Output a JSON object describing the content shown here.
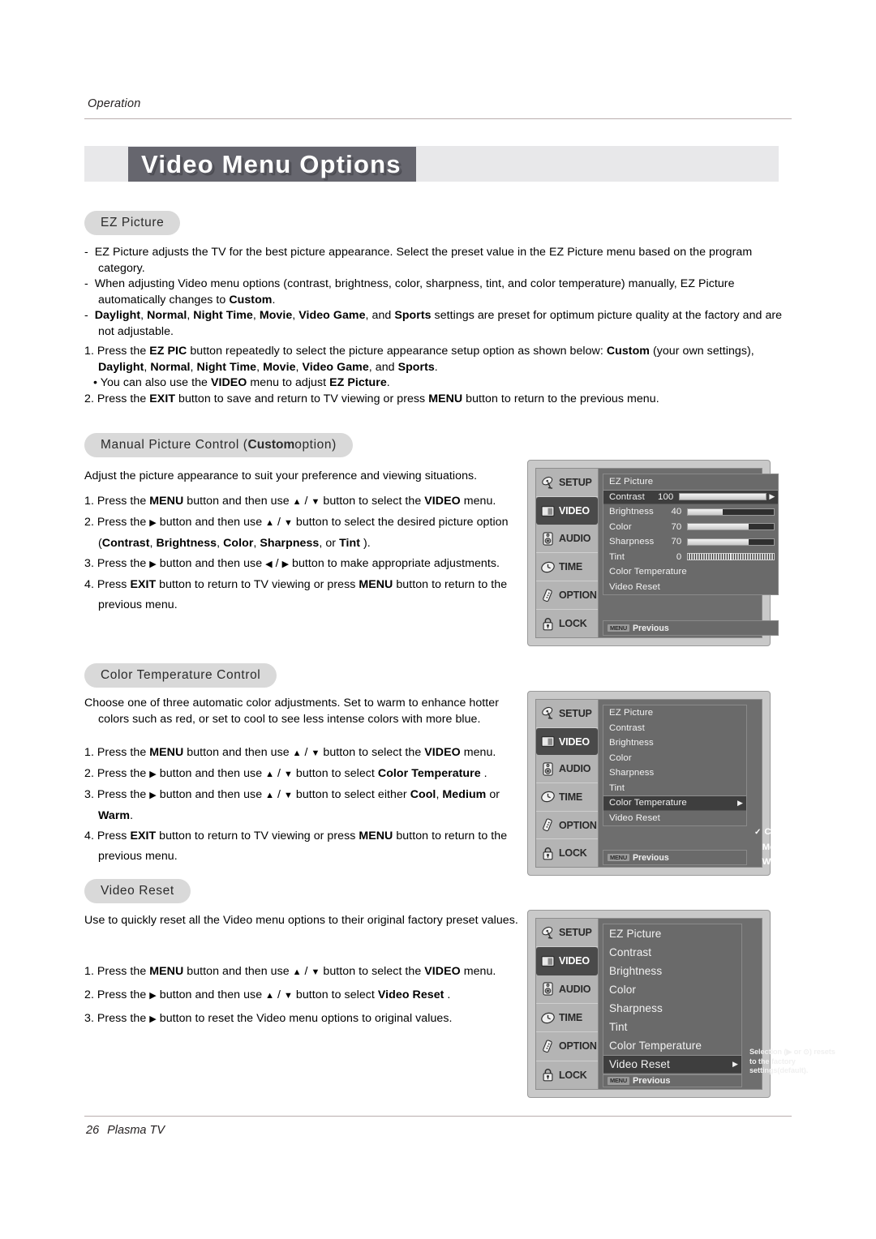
{
  "header": {
    "section_label": "Operation"
  },
  "title": {
    "text": "Video Menu Options"
  },
  "footer": {
    "page_number": "26",
    "product": "Plasma TV"
  },
  "sections": {
    "ez_picture": {
      "pill": "EZ Picture",
      "bullets": [
        "EZ Picture adjusts the TV for the best picture appearance. Select the preset value in the EZ Picture menu based on the program category.",
        "When adjusting Video menu options (contrast, brightness, color, sharpness, tint, and color temperature) manually, EZ Picture automatically changes to Custom.",
        "Daylight, Normal, Night Time, Movie, Video Game, and Sports settings are preset for optimum picture quality at the factory and are not adjustable."
      ],
      "steps": [
        "1. Press the EZ PIC button repeatedly to select the picture appearance setup option as shown below: Custom (your own settings), Daylight, Normal, Night Time, Movie, Video Game, and Sports.",
        "• You can also use the VIDEO menu to adjust EZ Picture.",
        "2. Press the EXIT button to save and return to TV viewing or press MENU button to return to the previous menu."
      ]
    },
    "manual_picture": {
      "pill_prefix": "Manual Picture Control (",
      "pill_bold": "Custom",
      "pill_suffix": " option)",
      "bullet": "Adjust the picture appearance to suit your preference and viewing situations.",
      "steps": [
        "1. Press the MENU button and then use ▲ / ▼ button to select the VIDEO menu.",
        "2. Press the ▶ button and then use ▲ / ▼ button to select the desired picture option (Contrast, Brightness, Color, Sharpness, or Tint ).",
        "3. Press the ▶ button and then use ◀ / ▶ button to make appropriate adjustments.",
        "4. Press EXIT button to return to TV viewing or press MENU button to return to the previous menu."
      ]
    },
    "color_temperature": {
      "pill": "Color Temperature Control",
      "bullet": "Choose one of three automatic color adjustments. Set to warm to enhance hotter colors such as red, or set to cool to see less intense colors with more blue.",
      "steps": [
        "1. Press the MENU button and then use ▲ / ▼ button to select the VIDEO menu.",
        "2. Press the ▶ button and then use ▲ / ▼ button to select Color Temperature .",
        "3. Press the ▶ button and then use ▲ / ▼ button to select either Cool, Medium or Warm.",
        "4. Press EXIT button to return to TV viewing or press MENU button to return to the previous menu."
      ]
    },
    "video_reset": {
      "pill": "Video Reset",
      "bullet": "Use to quickly reset all the Video menu options to their original factory preset values.",
      "steps": [
        "1. Press the MENU button and then use ▲ / ▼ button to select the VIDEO menu.",
        "2. Press the ▶ button and then use ▲ / ▼ button to select Video Reset .",
        "3. Press the ▶ button to reset the Video menu options to original values."
      ]
    }
  },
  "osd": {
    "sidebar": [
      {
        "label": "SETUP",
        "icon": "satellite-dish-icon"
      },
      {
        "label": "VIDEO",
        "icon": "tv-screen-icon"
      },
      {
        "label": "AUDIO",
        "icon": "speaker-icon"
      },
      {
        "label": "TIME",
        "icon": "clock-icon"
      },
      {
        "label": "OPTION",
        "icon": "remote-control-icon"
      },
      {
        "label": "LOCK",
        "icon": "padlock-icon"
      }
    ],
    "previous_key": "MENU",
    "previous_label": "Previous",
    "menu1": {
      "rows": [
        {
          "label": "EZ Picture",
          "value": "",
          "bar": null,
          "selected": false
        },
        {
          "label": "Contrast",
          "value": "100",
          "bar": 100,
          "selected": true
        },
        {
          "label": "Brightness",
          "value": "40",
          "bar": 40,
          "selected": false
        },
        {
          "label": "Color",
          "value": "70",
          "bar": 70,
          "selected": false
        },
        {
          "label": "Sharpness",
          "value": "70",
          "bar": 70,
          "selected": false
        },
        {
          "label": "Tint",
          "value": "0",
          "bar": "tint",
          "selected": false
        },
        {
          "label": "Color Temperature",
          "value": "",
          "bar": null,
          "selected": false
        },
        {
          "label": "Video Reset",
          "value": "",
          "bar": null,
          "selected": false
        }
      ]
    },
    "menu2": {
      "rows": [
        {
          "label": "EZ Picture",
          "selected": false
        },
        {
          "label": "Contrast",
          "selected": false
        },
        {
          "label": "Brightness",
          "selected": false
        },
        {
          "label": "Color",
          "selected": false
        },
        {
          "label": "Sharpness",
          "selected": false
        },
        {
          "label": "Tint",
          "selected": false
        },
        {
          "label": "Color Temperature",
          "selected": true
        },
        {
          "label": "Video Reset",
          "selected": false
        }
      ],
      "submenu": [
        {
          "label": "Cool",
          "checked": true
        },
        {
          "label": "Medium",
          "checked": false
        },
        {
          "label": "Warm",
          "checked": false
        }
      ]
    },
    "menu3": {
      "rows": [
        {
          "label": "EZ Picture",
          "selected": false
        },
        {
          "label": "Contrast",
          "selected": false
        },
        {
          "label": "Brightness",
          "selected": false
        },
        {
          "label": "Color",
          "selected": false
        },
        {
          "label": "Sharpness",
          "selected": false
        },
        {
          "label": "Tint",
          "selected": false
        },
        {
          "label": "Color Temperature",
          "selected": false
        },
        {
          "label": "Video Reset",
          "selected": true
        }
      ],
      "tooltip": "Selection (▶ or ⊙) resets to the factory settings(default)."
    }
  }
}
